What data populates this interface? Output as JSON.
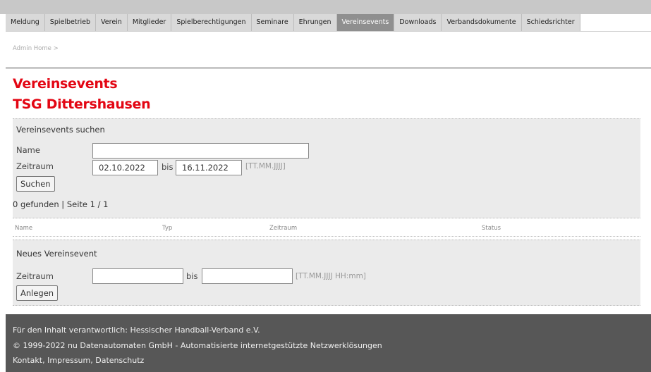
{
  "nav": {
    "items": [
      {
        "label": "Meldung"
      },
      {
        "label": "Spielbetrieb"
      },
      {
        "label": "Verein"
      },
      {
        "label": "Mitglieder"
      },
      {
        "label": "Spielberechtigungen"
      },
      {
        "label": "Seminare"
      },
      {
        "label": "Ehrungen"
      },
      {
        "label": "Vereinsevents"
      },
      {
        "label": "Downloads"
      },
      {
        "label": "Verbandsdokumente"
      },
      {
        "label": "Schiedsrichter"
      }
    ],
    "active": "Vereinsevents"
  },
  "breadcrumb": "Admin Home >",
  "page": {
    "title": "Vereinsevents",
    "club": "TSG Dittershausen"
  },
  "search": {
    "title": "Vereinsevents suchen",
    "name_label": "Name",
    "name_value": "",
    "period_label": "Zeitraum",
    "from": "02.10.2022",
    "bis": "bis",
    "to": "16.11.2022",
    "date_hint": "[TT.MM.JJJJ]",
    "button": "Suchen"
  },
  "results": {
    "summary": "0 gefunden | Seite 1 / 1",
    "columns": [
      "Name",
      "Typ",
      "Zeitraum",
      "Status"
    ]
  },
  "new_event": {
    "title": "Neues Vereinsevent",
    "period_label": "Zeitraum",
    "from": "",
    "bis": "bis",
    "to": "",
    "hint": "[TT.MM.JJJJ HH:mm]",
    "button": "Anlegen"
  },
  "footer": {
    "responsible": "Für den Inhalt verantwortlich: Hessischer Handball-Verband e.V.",
    "copyright": "© 1999-2022 nu Datenautomaten GmbH - Automatisierte internetgestützte Netzwerklösungen",
    "links": [
      "Kontakt",
      "Impressum",
      "Datenschutz"
    ]
  },
  "colors": {
    "accent": "#e30613",
    "nav_active": "#8f8f8f",
    "footer_bg": "#575757"
  }
}
